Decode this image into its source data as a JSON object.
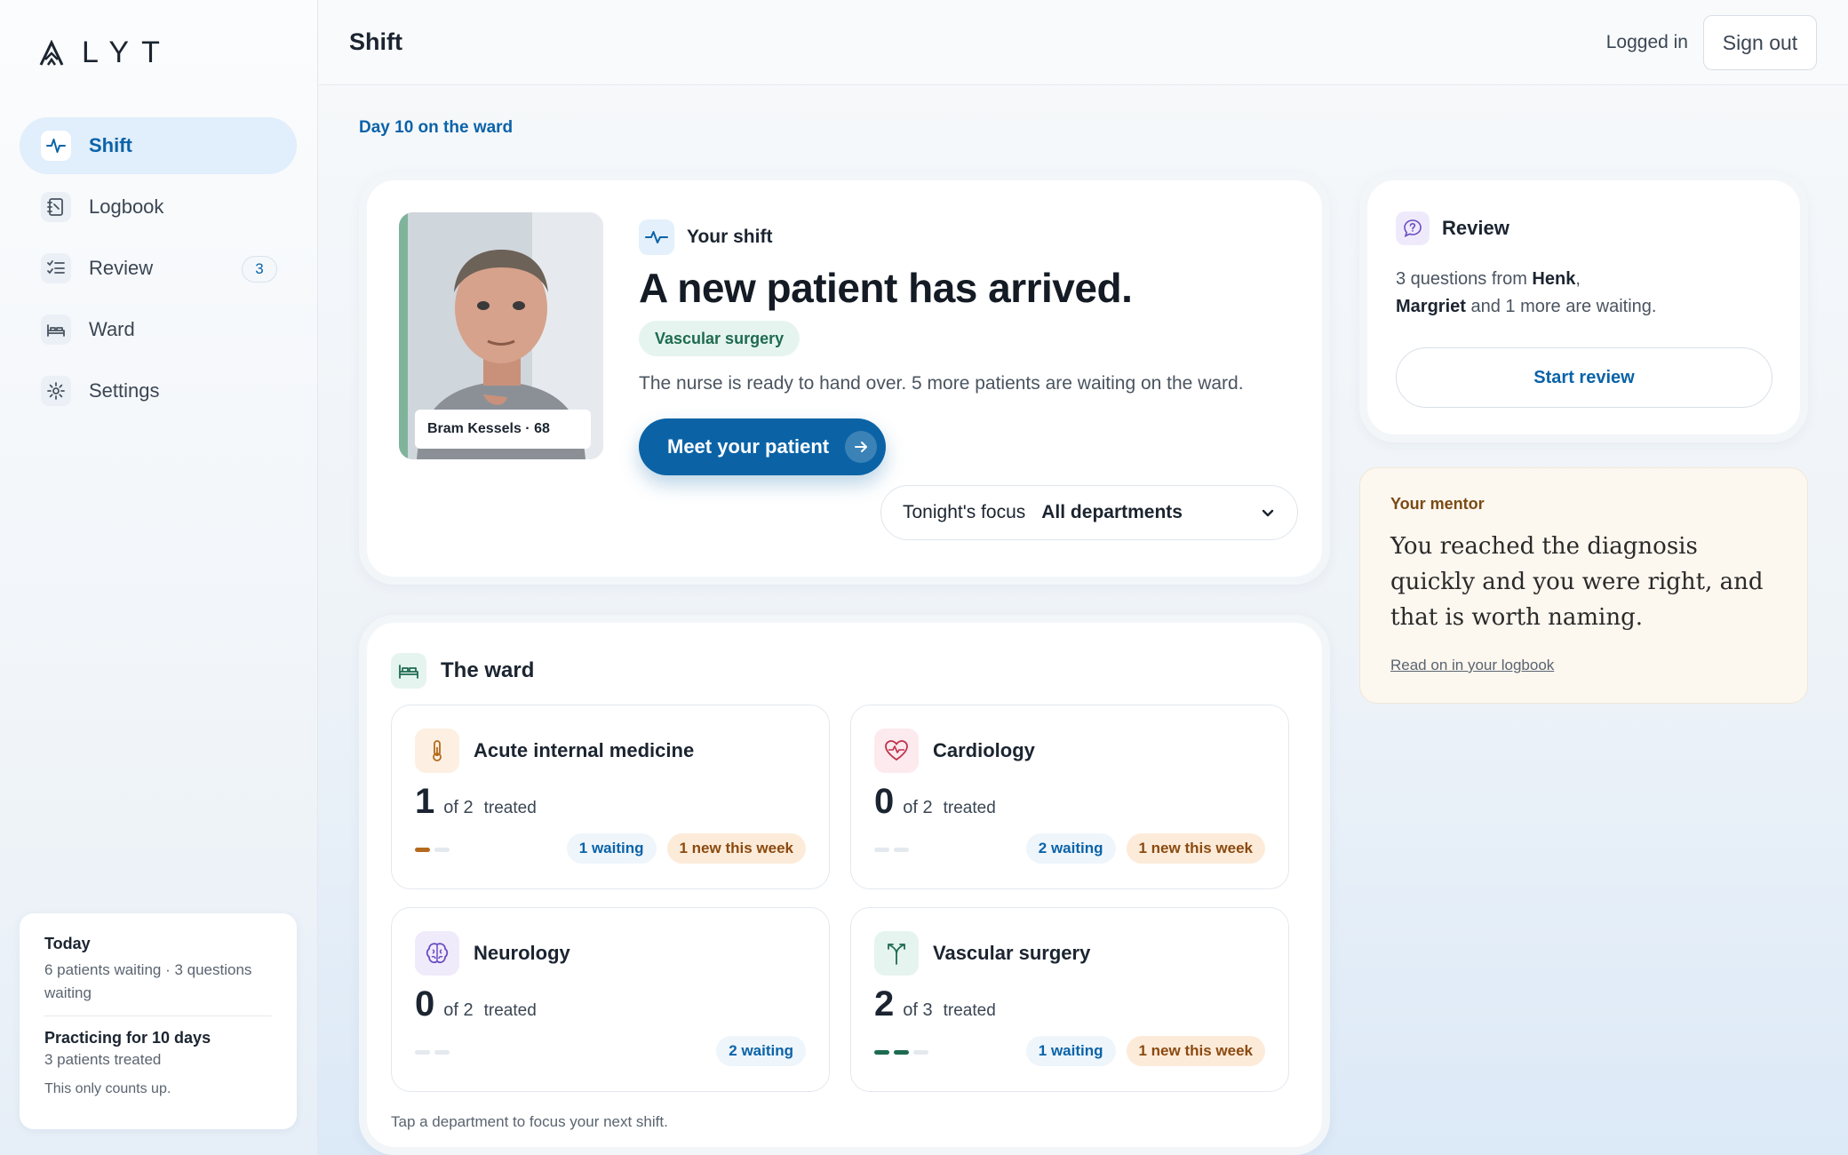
{
  "app": {
    "logo_text": "LYT",
    "logo_mark": "A"
  },
  "sidebar": {
    "items": [
      {
        "label": "Shift",
        "icon": "pulse-icon",
        "active": true
      },
      {
        "label": "Logbook",
        "icon": "notebook-icon"
      },
      {
        "label": "Review",
        "icon": "checklist-icon",
        "badge": "3"
      },
      {
        "label": "Ward",
        "icon": "bed-icon"
      },
      {
        "label": "Settings",
        "icon": "gear-icon"
      }
    ],
    "today": {
      "title": "Today",
      "summary": "6 patients waiting · 3 questions waiting",
      "practice_title": "Practicing for 10 days",
      "practice_sub": "3 patients treated",
      "note": "This only counts up."
    }
  },
  "header": {
    "title": "Shift",
    "logged_in": "Logged in",
    "signout": "Sign out"
  },
  "day_label": "Day 10 on the ward",
  "shift": {
    "section_label": "Your shift",
    "title": "A new patient has arrived.",
    "department": "Vascular surgery",
    "description": "The nurse is ready to hand over. 5 more patients are waiting on the ward.",
    "patient_label": "Bram Kessels · 68",
    "cta": "Meet your patient",
    "focus_label": "Tonight's focus",
    "focus_value": "All departments"
  },
  "ward": {
    "title": "The ward",
    "footer": "Tap a department to focus your next shift.",
    "departments": [
      {
        "name": "Acute internal medicine",
        "icon": "thermometer-icon",
        "treated": "1",
        "of": "of 2",
        "treated_label": "treated",
        "waiting": "1 waiting",
        "new": "1 new this week",
        "progress": 0.5,
        "accent": "#b46a1c"
      },
      {
        "name": "Cardiology",
        "icon": "heart-pulse-icon",
        "treated": "0",
        "of": "of 2",
        "treated_label": "treated",
        "waiting": "2 waiting",
        "new": "1 new this week",
        "progress": 0,
        "accent": "#c0304a"
      },
      {
        "name": "Neurology",
        "icon": "brain-icon",
        "treated": "0",
        "of": "of 2",
        "treated_label": "treated",
        "waiting": "2 waiting",
        "progress": 0,
        "accent": "#6a4cc2"
      },
      {
        "name": "Vascular surgery",
        "icon": "branch-icon",
        "treated": "2",
        "of": "of 3",
        "treated_label": "treated",
        "waiting": "1 waiting",
        "new": "1 new this week",
        "progress": 0.667,
        "accent": "#1e6b50"
      }
    ]
  },
  "review": {
    "title": "Review",
    "text_prefix": "3 questions from ",
    "name1": "Henk",
    "comma": ",",
    "name2": "Margriet",
    "text_suffix": " and 1 more are waiting.",
    "button": "Start review"
  },
  "mentor": {
    "label": "Your mentor",
    "quote": "You reached the diagnosis quickly and you were right, and that is worth naming.",
    "link": "Read on in your logbook"
  },
  "colors": {
    "accent": "#0b63a6",
    "success": "#1e6b50",
    "warning": "#8a4a10"
  }
}
